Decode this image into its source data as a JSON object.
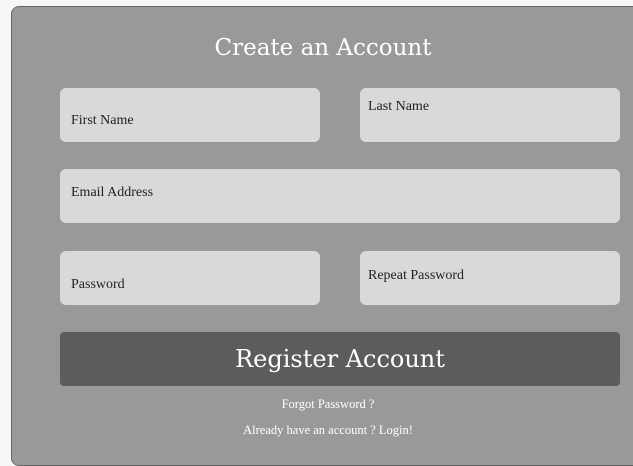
{
  "form": {
    "title": "Create an Account",
    "first_name_placeholder": "First Name",
    "last_name_placeholder": "Last Name",
    "email_placeholder": "Email Address",
    "password_placeholder": "Password",
    "repeat_password_placeholder": "Repeat Password",
    "register_label": "Register Account",
    "forgot_password_label": "Forgot Password ?",
    "login_label": "Already have an account ? Login!"
  },
  "colors": {
    "card_background": "#999999",
    "field_background": "#d9d9d9",
    "button_background": "#5c5c5a",
    "text_light": "#ffffff"
  }
}
